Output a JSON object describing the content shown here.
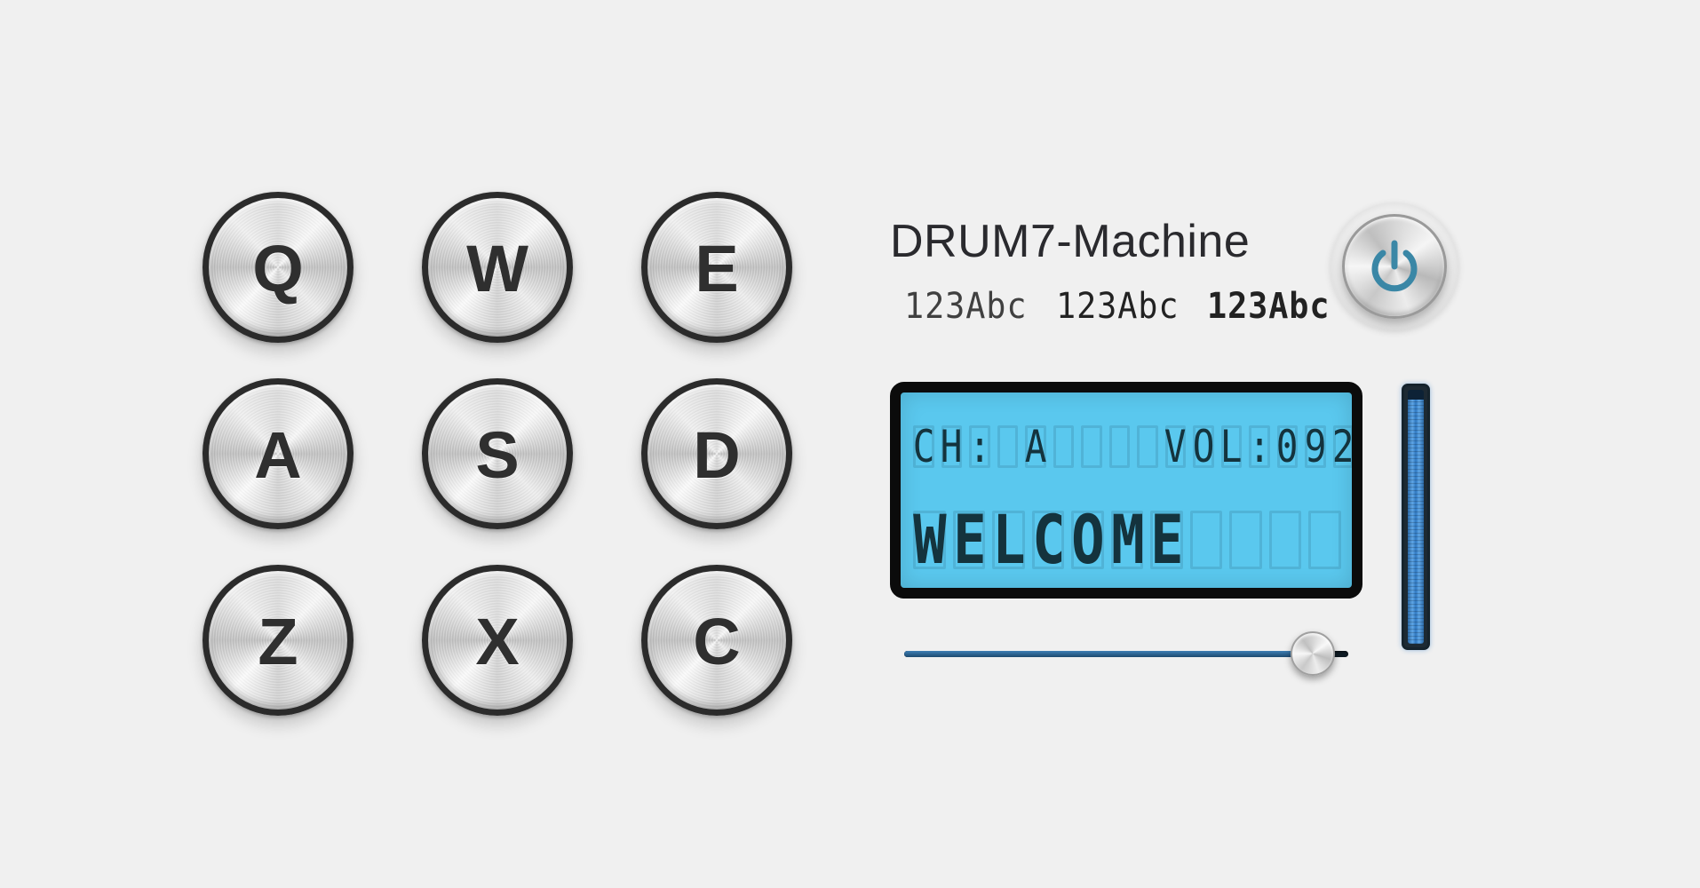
{
  "app": {
    "title": "DRUM7-Machine",
    "font_samples": [
      "123Abc",
      "123Abc",
      "123Abc"
    ]
  },
  "pads": [
    {
      "key": "Q",
      "row": 0,
      "col": 0
    },
    {
      "key": "W",
      "row": 0,
      "col": 1
    },
    {
      "key": "E",
      "row": 0,
      "col": 2
    },
    {
      "key": "A",
      "row": 1,
      "col": 0
    },
    {
      "key": "S",
      "row": 1,
      "col": 1
    },
    {
      "key": "D",
      "row": 1,
      "col": 2
    },
    {
      "key": "Z",
      "row": 2,
      "col": 0
    },
    {
      "key": "X",
      "row": 2,
      "col": 1
    },
    {
      "key": "C",
      "row": 2,
      "col": 2
    }
  ],
  "power": {
    "icon": "power-icon",
    "color": "#3a87a6"
  },
  "lcd": {
    "line1": "CH: A    VOL:092",
    "line2": "WELCOME  ",
    "background_color": "#5ac8ee",
    "text_color": "#14333d"
  },
  "volume": {
    "value": 92,
    "max": 100
  },
  "meter": {
    "level": 0.96,
    "color": "#4a90d9"
  }
}
